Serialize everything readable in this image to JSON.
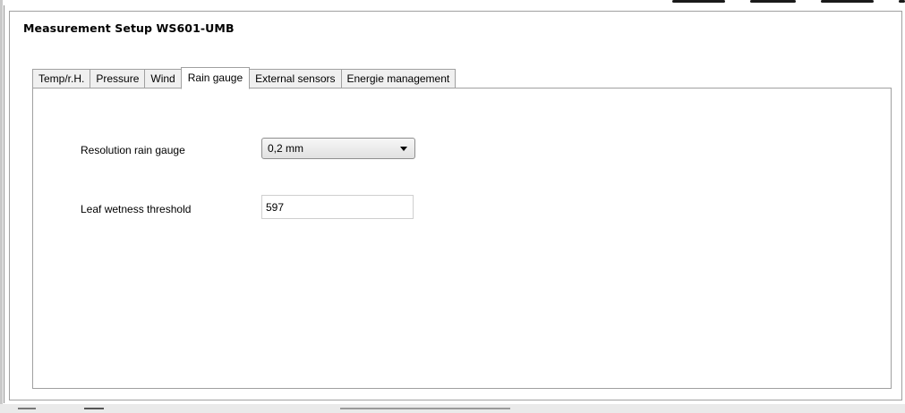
{
  "window": {
    "title": "Measurement Setup  WS601-UMB"
  },
  "tabs": [
    {
      "label": "Temp/r.H.",
      "active": false
    },
    {
      "label": "Pressure",
      "active": false
    },
    {
      "label": "Wind",
      "active": false
    },
    {
      "label": "Rain gauge",
      "active": true
    },
    {
      "label": "External sensors",
      "active": false
    },
    {
      "label": "Energie management",
      "active": false
    }
  ],
  "rain_gauge": {
    "resolution_label": "Resolution rain gauge",
    "resolution_value": "0,2 mm",
    "leaf_label": "Leaf wetness threshold",
    "leaf_value": "597"
  },
  "colors": {
    "panel_border": "#a0a0a0",
    "tab_inactive_bg": "#f0f0f0",
    "background": "#ffffff"
  }
}
